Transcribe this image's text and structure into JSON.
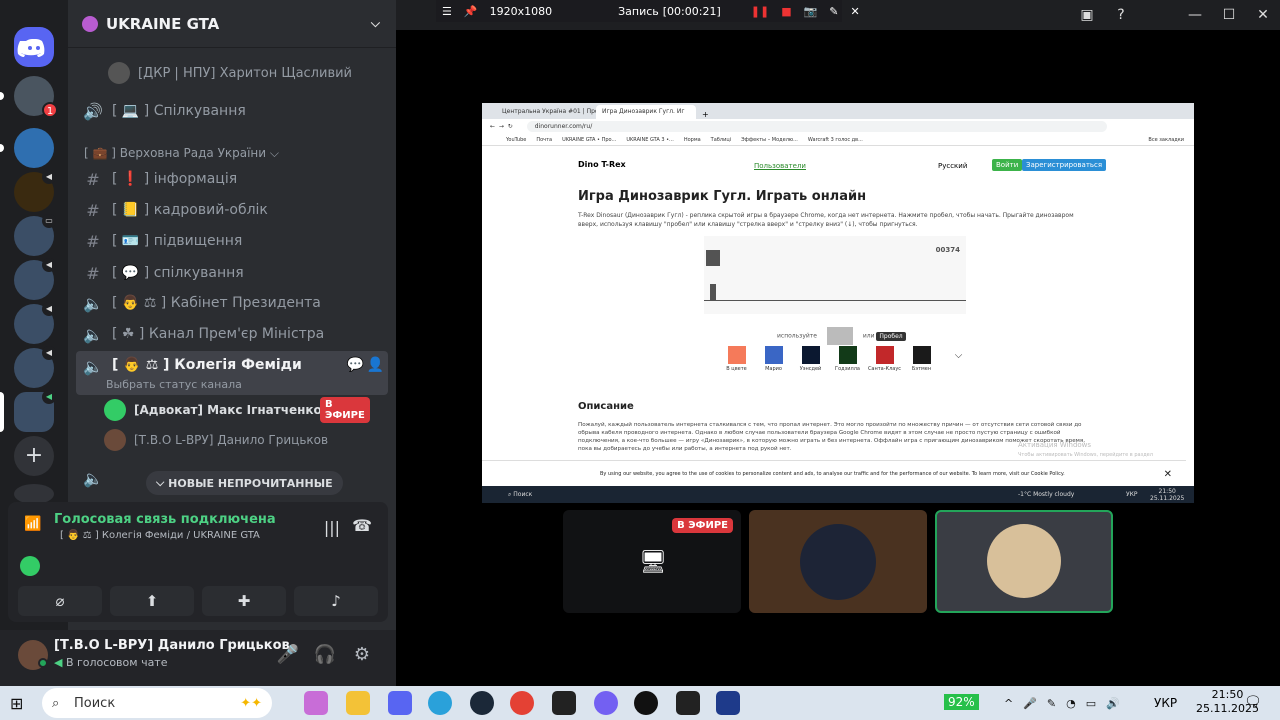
{
  "recorder": {
    "resolution": "1920x1080",
    "label": "Запись",
    "time": "[00:00:21]"
  },
  "server": {
    "name": "UKRAINE GTA"
  },
  "rail": {
    "badge": "1"
  },
  "channels": {
    "partial_top": "[ДКР | НПУ] Харитон Щасливий",
    "spilkuvannia_voice": "[ 💻 ] Спілкування",
    "category": "[ 💼 ] Верховна Рада України",
    "items": [
      {
        "label": "[ ❗ ] інформація"
      },
      {
        "label": "[ 📒 ] кадровий-облік"
      },
      {
        "label": "[ 🪪 ] підвищення"
      },
      {
        "label": "[ 💬 ] спілкування"
      },
      {
        "label": "[ 👨 ⚖ ] Кабінет Президента"
      },
      {
        "label": "[ ☘ ] Канал Прем'єр Міністра"
      },
      {
        "label": "[ 👨 ⚖ ] Колегія Феміди"
      }
    ],
    "status_hint": "Выбрать статус канала",
    "members": [
      {
        "name": "[Адвокат] Макс Ігнатченко",
        "live": "В ЭФИРЕ"
      },
      {
        "name": "[Т.В.О L-ВРУ] Данило Грицьков"
      }
    ],
    "unread": "НОВЫЕ НЕПРОЧИТАННЫЕ"
  },
  "voice": {
    "status": "Голосовая связь подключена",
    "location": "[ 👨 ⚖ ] Колегія Феміди / UKRAINE GTA"
  },
  "user": {
    "name": "[Т.В.О L-ВРУ] Данило Грицьков",
    "status": "В голосовом чате"
  },
  "browser": {
    "tabs": [
      "Центральна Україна #01 | Про",
      "Игра Динозаврик Гугл. Иг"
    ],
    "url": "dinorunner.com/ru/",
    "bookmarks": [
      "YouTube",
      "Почта",
      "UKRAINE GTA • Про...",
      "UKRAINE GTA 3 •...",
      "Норма",
      "Таблиці",
      "Эффекты – Моделю...",
      "Warcraft 3 голос дв...",
      "Все закладки"
    ],
    "site_logo": "Dino T-Rex",
    "nav_link": "Пользователи",
    "lang": "Русский",
    "login": "Войти",
    "register": "Зарегистрироваться",
    "title": "Игра Динозаврик Гугл. Играть онлайн",
    "intro": "T-Rex Dinosaur (Динозаврик Гугл) - реплика скрытой игры в браузере Chrome, когда нет интернета. Нажмите пробел, чтобы начать. Прыгайте динозавром вверх, используя клавишу \"пробел\" или клавишу \"стрелка вверх\" и \"стрелку вниз\" (↓), чтобы пригнуться.",
    "score": "00374",
    "use": "используйте",
    "or": "или",
    "space": "Пробел",
    "skins": [
      "В цвете",
      "Марио",
      "Уэнсдей",
      "Годзилла",
      "Санта-Клаус",
      "Бэтмен"
    ],
    "desc_title": "Описание",
    "desc": "Пожалуй, каждый пользователь интернета сталкивался с тем, что пропал интернет. Это могло произойти по множеству причин — от отсутствия сети сотовой связи до обрыва кабеля проводного интернета. Однако в любом случае пользователи браузера Google Chrome видят в этом случае не просто пустую страницу с ошибкой подключения, а кое-что большее — игру «Динозаврик», в которую можно играть и без интернета. Оффлайн игра с пригающим динозавриком поможет скоротать время, пока вы добираетесь до учебы или работы, а интернета под рукой нет.",
    "activation": "Активация Windows",
    "activation_sub": "Чтобы активировать Windows, перейдите в раздел",
    "cookie": "By using our website, you agree to the use of cookies to personalize content and ads, to analyse our traffic and for the performance of our website. To learn more, visit our Cookie Policy.",
    "inner_search": "Поиск",
    "inner_weather": "-1°C  Mostly cloudy",
    "inner_lang": "УКР",
    "inner_time": "21:50",
    "inner_date": "25.11.2025"
  },
  "tiles": {
    "live": "В ЭФИРЕ"
  },
  "taskbar": {
    "search": "Поиск",
    "battery": "92%",
    "lang": "УКР",
    "time": "21:50",
    "date": "25.11.2025"
  }
}
